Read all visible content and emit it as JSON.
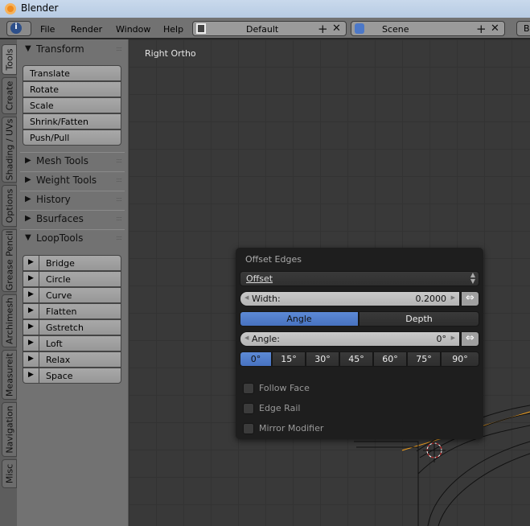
{
  "app": {
    "title": "Blender"
  },
  "header": {
    "menus": [
      "File",
      "Render",
      "Window",
      "Help"
    ],
    "layout": "Default",
    "scene": "Scene",
    "cut_button": "B"
  },
  "vtabs": [
    "Tools",
    "Create",
    "Shading / UVs",
    "Options",
    "Grease Pencil",
    "Archimesh",
    "Measureit",
    "Navigation",
    "Misc"
  ],
  "panel": {
    "transform": {
      "label": "Transform",
      "buttons": [
        "Translate",
        "Rotate",
        "Scale",
        "Shrink/Fatten",
        "Push/Pull"
      ]
    },
    "collapsed": [
      "Mesh Tools",
      "Weight Tools",
      "History",
      "Bsurfaces"
    ],
    "looptools": {
      "label": "LoopTools",
      "buttons": [
        "Bridge",
        "Circle",
        "Curve",
        "Flatten",
        "Gstretch",
        "Loft",
        "Relax",
        "Space"
      ]
    }
  },
  "viewport": {
    "name": "Right Ortho"
  },
  "popup": {
    "title": "Offset Edges",
    "mode": "Offset",
    "width_label": "Width:",
    "width_value": "0.2000",
    "tabs": [
      "Angle",
      "Depth"
    ],
    "active_tab": "Angle",
    "angle_label": "Angle:",
    "angle_value": "0°",
    "presets": [
      "0°",
      "15°",
      "30°",
      "45°",
      "60°",
      "75°",
      "90°"
    ],
    "active_preset": "0°",
    "checkboxes": [
      {
        "label": "Follow Face",
        "checked": false
      },
      {
        "label": "Edge Rail",
        "checked": false
      },
      {
        "label": "Mirror Modifier",
        "checked": false
      }
    ]
  },
  "colors": {
    "accent": "#5680c2",
    "selection_edge": "#ffa000"
  }
}
